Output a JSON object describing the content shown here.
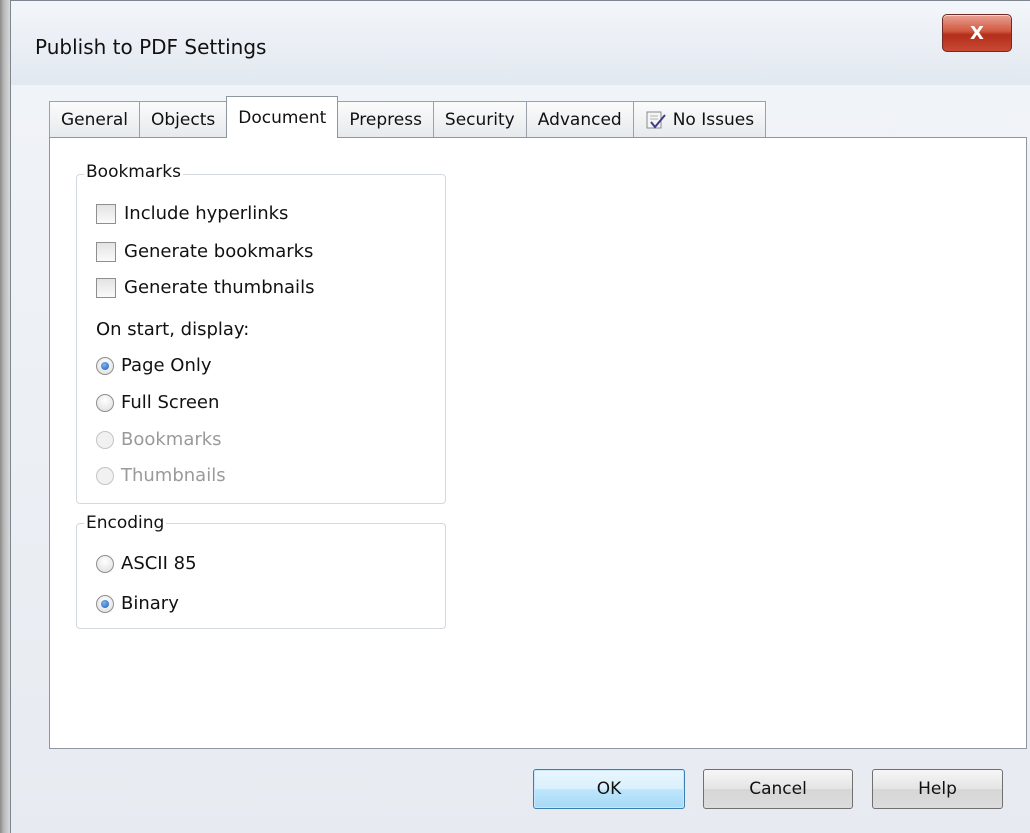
{
  "window": {
    "title": "Publish to PDF Settings",
    "close_label": "X"
  },
  "tabs": [
    {
      "label": "General",
      "active": false
    },
    {
      "label": "Objects",
      "active": false
    },
    {
      "label": "Document",
      "active": true
    },
    {
      "label": "Prepress",
      "active": false
    },
    {
      "label": "Security",
      "active": false
    },
    {
      "label": "Advanced",
      "active": false
    },
    {
      "label": "No Issues",
      "active": false,
      "icon": "checklist-icon"
    }
  ],
  "bookmarks": {
    "group_label": "Bookmarks",
    "checkboxes": [
      {
        "label": "Include hyperlinks",
        "checked": false
      },
      {
        "label": "Generate bookmarks",
        "checked": false
      },
      {
        "label": "Generate thumbnails",
        "checked": false
      }
    ],
    "display_label": "On start, display:",
    "display_options": [
      {
        "label": "Page Only",
        "checked": true,
        "enabled": true
      },
      {
        "label": "Full Screen",
        "checked": false,
        "enabled": true
      },
      {
        "label": "Bookmarks",
        "checked": false,
        "enabled": false
      },
      {
        "label": "Thumbnails",
        "checked": false,
        "enabled": false
      }
    ]
  },
  "encoding": {
    "group_label": "Encoding",
    "options": [
      {
        "label": "ASCII 85",
        "checked": false
      },
      {
        "label": "Binary",
        "checked": true
      }
    ]
  },
  "buttons": {
    "ok": "OK",
    "cancel": "Cancel",
    "help": "Help"
  },
  "colors": {
    "close_button": "#c84a33",
    "radio_selected": "#1c5db8",
    "default_button_border": "#3c7fb1"
  }
}
